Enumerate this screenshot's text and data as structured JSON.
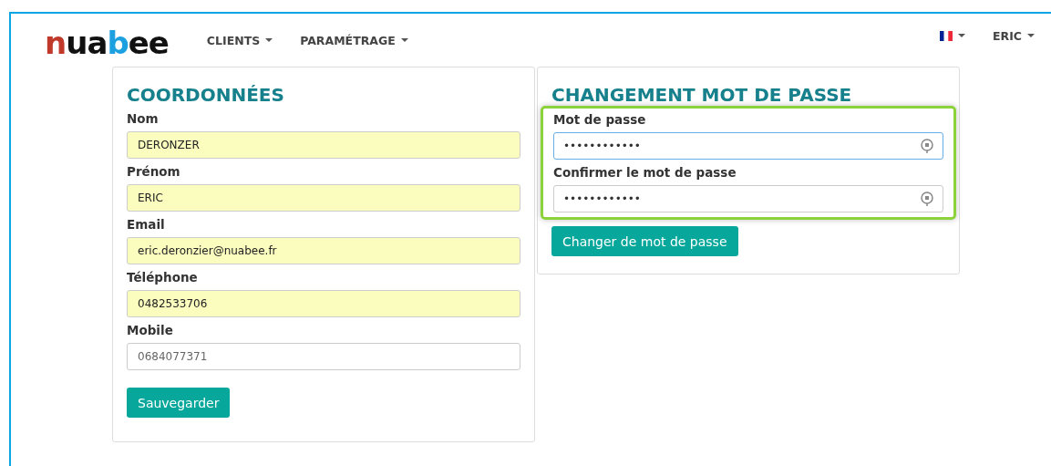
{
  "navbar": {
    "logo": "nuabee",
    "menus": [
      {
        "label": "CLIENTS"
      },
      {
        "label": "PARAMÉTRAGE"
      }
    ],
    "user": "ERIC"
  },
  "contact_panel": {
    "title": "COORDONNÉES",
    "fields": [
      {
        "label": "Nom",
        "value": "DERONZER",
        "autofilled": true
      },
      {
        "label": "Prénom",
        "value": "ERIC",
        "autofilled": true
      },
      {
        "label": "Email",
        "value": "eric.deronzier@nuabee.fr",
        "autofilled": true
      },
      {
        "label": "Téléphone",
        "value": "0482533706",
        "autofilled": true
      },
      {
        "label": "Mobile",
        "value": "0684077371",
        "autofilled": false
      }
    ],
    "button": "Sauvegarder"
  },
  "password_panel": {
    "title": "CHANGEMENT MOT DE PASSE",
    "highlighted": true,
    "fields": [
      {
        "label": "Mot de passe",
        "value": "••••••••••••",
        "focused": true
      },
      {
        "label": "Confirmer le mot de passe",
        "value": "••••••••••••",
        "focused": false
      }
    ],
    "button": "Changer de mot de passe"
  }
}
